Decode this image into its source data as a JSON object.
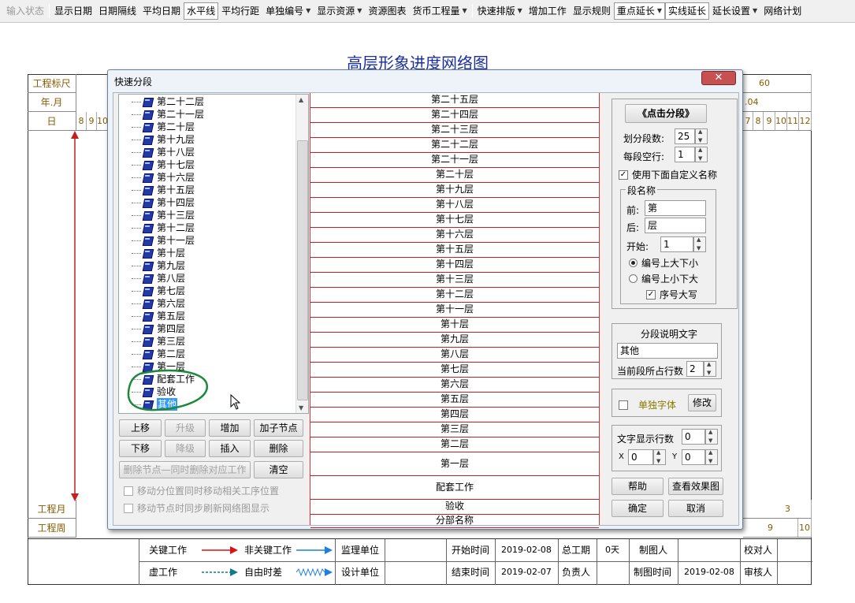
{
  "toolbar": {
    "items": [
      "输入状态",
      "显示日期",
      "日期隔线",
      "平均日期",
      "水平线",
      "平均行距",
      "单独编号",
      "显示资源",
      "资源图表",
      "货币工程量",
      "快速排版",
      "增加工作",
      "显示规则",
      "重点延长",
      "实线延长",
      "延长设置",
      "网络计划"
    ]
  },
  "chart": {
    "title": "高层形象进度网络图",
    "row_labels": [
      "工程标尺",
      "年.月",
      "日",
      "工程月",
      "工程周"
    ],
    "scale_value": "60",
    "month_value": ".04",
    "days_left": [
      "8",
      "9",
      "10"
    ],
    "days_right": [
      "7",
      "8",
      "9",
      "10",
      "11",
      "12"
    ],
    "month_number": "3",
    "week_numbers": [
      "9",
      "10"
    ]
  },
  "legend": {
    "critical": "关键工作",
    "noncritical": "非关键工作",
    "dummy": "虚工作",
    "free_float": "自由时差",
    "supervisor": "监理单位",
    "designer": "设计单位",
    "start_label": "开始时间",
    "start_date": "2019-02-08",
    "end_label": "结束时间",
    "end_date": "2019-02-07",
    "total_label": "总工期",
    "total_value": "0天",
    "owner_label": "负责人",
    "maker_label": "制图人",
    "maketime_label": "制图时间",
    "maketime_value": "2019-02-08",
    "checker_label": "校对人",
    "reviewer_label": "审核人"
  },
  "dialog": {
    "title": "快速分段",
    "close": "✕",
    "tree_items": [
      "第二十二层",
      "第二十一层",
      "第二十层",
      "第十九层",
      "第十八层",
      "第十七层",
      "第十六层",
      "第十五层",
      "第十四层",
      "第十三层",
      "第十二层",
      "第十一层",
      "第十层",
      "第九层",
      "第八层",
      "第七层",
      "第六层",
      "第五层",
      "第四层",
      "第三层",
      "第二层",
      "第一层",
      "配套工作",
      "验收",
      "其他"
    ],
    "buttons": {
      "up": "上移",
      "promote": "升级",
      "add": "增加",
      "add_child": "加子节点",
      "down": "下移",
      "demote": "降级",
      "insert": "插入",
      "delete": "删除",
      "delete_node": "删除节点—同时删除对应工作",
      "clear": "清空"
    },
    "check_move": "移动分位置同时移动相关工序位置",
    "check_refresh": "移动节点时同步刷新网络图显示",
    "segments": [
      "第二十五层",
      "第二十四层",
      "第二十三层",
      "第二十二层",
      "第二十一层",
      "第二十层",
      "第十九层",
      "第十八层",
      "第十七层",
      "第十六层",
      "第十五层",
      "第十四层",
      "第十三层",
      "第十二层",
      "第十一层",
      "第十层",
      "第九层",
      "第八层",
      "第七层",
      "第六层",
      "第五层",
      "第四层",
      "第三层",
      "第二层",
      "第一层",
      "配套工作",
      "验收",
      "分部名称"
    ],
    "right": {
      "click_segment": "《点击分段》",
      "seg_count_label": "划分段数:",
      "seg_count": "25",
      "empty_rows_label": "每段空行:",
      "empty_rows": "1",
      "use_custom": "使用下面自定义名称",
      "seg_name_group": "段名称",
      "prefix_label": "前:",
      "prefix": "第",
      "suffix_label": "后:",
      "suffix": "层",
      "start_label": "开始:",
      "start": "1",
      "order_desc": "编号上大下小",
      "order_asc": "编号上小下大",
      "uppercase": "序号大写",
      "desc_title": "分段说明文字",
      "desc_value": "其他",
      "rows_label": "当前段所占行数",
      "rows_value": "2",
      "separate_font": "单独字体",
      "modify": "修改",
      "text_rows_label": "文字显示行数",
      "text_rows": "0",
      "x_label": "X",
      "x_value": "0",
      "y_label": "Y",
      "y_value": "0",
      "help": "帮助",
      "preview": "查看效果图",
      "ok": "确定",
      "cancel": "取消"
    }
  },
  "colors": {
    "title_blue": "#1a2fa0",
    "label_brown": "#8b5a00",
    "red": "#c32020",
    "annotation_green": "#1a8a3a"
  }
}
